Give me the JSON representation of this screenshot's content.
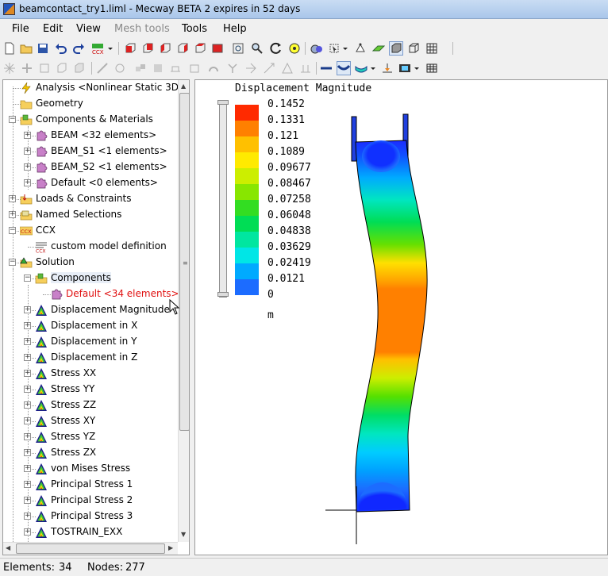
{
  "window": {
    "title": "beamcontact_try1.liml - Mecway BETA 2 expires in 52 days"
  },
  "menu": [
    {
      "label": "File",
      "enabled": true
    },
    {
      "label": "Edit",
      "enabled": true
    },
    {
      "label": "View",
      "enabled": true
    },
    {
      "label": "Mesh tools",
      "enabled": false
    },
    {
      "label": "Tools",
      "enabled": true
    },
    {
      "label": "Help",
      "enabled": true
    }
  ],
  "tree": {
    "items": [
      {
        "label": "Analysis <Nonlinear Static 3D:",
        "icon": "analysis-icon"
      },
      {
        "label": "Geometry",
        "icon": "folder-icon"
      },
      {
        "label": "Components & Materials",
        "icon": "components-icon"
      },
      {
        "label": "BEAM <32 elements>",
        "icon": "puzzle-piece-icon"
      },
      {
        "label": "BEAM_S1 <1 elements>",
        "icon": "puzzle-piece-icon"
      },
      {
        "label": "BEAM_S2 <1 elements>",
        "icon": "puzzle-piece-icon"
      },
      {
        "label": "Default <0 elements>",
        "icon": "puzzle-piece-icon"
      },
      {
        "label": "Loads & Constraints",
        "icon": "loads-icon"
      },
      {
        "label": "Named Selections",
        "icon": "named-selections-icon"
      },
      {
        "label": "CCX",
        "icon": "ccx-icon"
      },
      {
        "label": "custom model definition",
        "icon": "ccx-custom-icon"
      },
      {
        "label": "Solution",
        "icon": "solution-icon"
      },
      {
        "label": "Components",
        "icon": "components-icon"
      },
      {
        "label": "Default <34 elements>",
        "icon": "puzzle-piece-icon"
      },
      {
        "label": "Displacement Magnitude",
        "icon": "result-triangle-icon"
      },
      {
        "label": "Displacement in X",
        "icon": "result-triangle-icon"
      },
      {
        "label": "Displacement in Y",
        "icon": "result-triangle-icon"
      },
      {
        "label": "Displacement in Z",
        "icon": "result-triangle-icon"
      },
      {
        "label": "Stress XX",
        "icon": "result-triangle-icon"
      },
      {
        "label": "Stress YY",
        "icon": "result-triangle-icon"
      },
      {
        "label": "Stress ZZ",
        "icon": "result-triangle-icon"
      },
      {
        "label": "Stress XY",
        "icon": "result-triangle-icon"
      },
      {
        "label": "Stress YZ",
        "icon": "result-triangle-icon"
      },
      {
        "label": "Stress ZX",
        "icon": "result-triangle-icon"
      },
      {
        "label": "von Mises Stress",
        "icon": "result-triangle-icon"
      },
      {
        "label": "Principal Stress 1",
        "icon": "result-triangle-icon"
      },
      {
        "label": "Principal Stress 2",
        "icon": "result-triangle-icon"
      },
      {
        "label": "Principal Stress 3",
        "icon": "result-triangle-icon"
      },
      {
        "label": "TOSTRAIN_EXX",
        "icon": "result-triangle-icon"
      }
    ]
  },
  "legend": {
    "title": "Displacement Magnitude",
    "unit": "m",
    "labels": [
      "0.1452",
      "0.1331",
      "0.121",
      "0.1089",
      "0.09677",
      "0.08467",
      "0.07258",
      "0.06048",
      "0.04838",
      "0.03629",
      "0.02419",
      "0.0121",
      "0"
    ],
    "colors": [
      "#ff2a00",
      "#ff8000",
      "#ffc000",
      "#ffea00",
      "#ccee00",
      "#88e600",
      "#33dd22",
      "#00dd55",
      "#00e6a0",
      "#00e6e6",
      "#00aaff",
      "#1c6cff",
      "#1030ff"
    ]
  },
  "status": {
    "elements_label": "Elements:",
    "elements_value": "34",
    "nodes_label": "Nodes:",
    "nodes_value": "277"
  }
}
